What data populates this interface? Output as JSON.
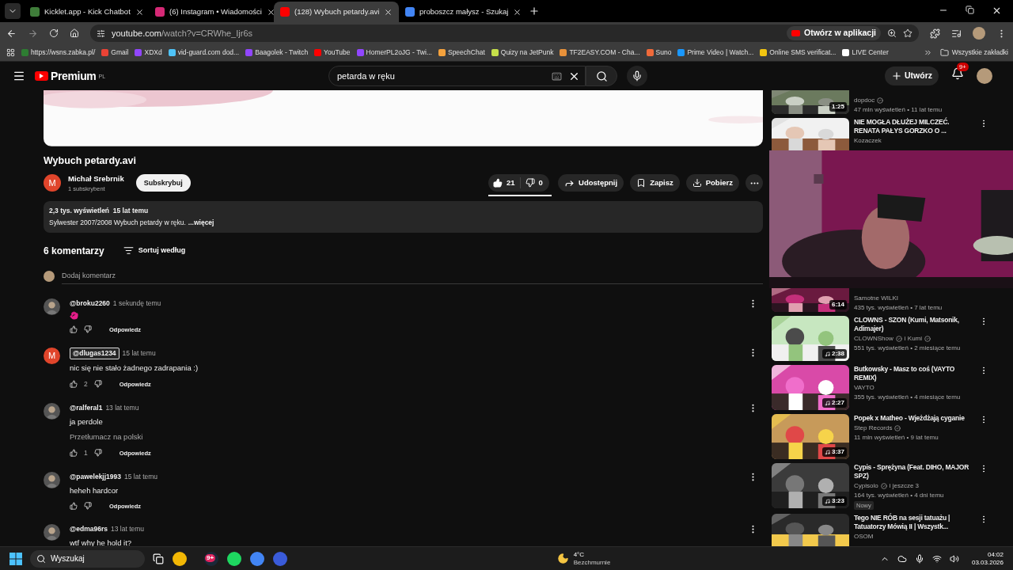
{
  "browser": {
    "tabs": [
      {
        "title": "Kicklet.app - Kick Chatbot",
        "selected": false,
        "color": "#3f7d3a"
      },
      {
        "title": "(6) Instagram • Wiadomości",
        "selected": false,
        "color": "#d62976"
      },
      {
        "title": "(128) Wybuch petardy.avi",
        "selected": true,
        "color": "#ff0000"
      },
      {
        "title": "proboszcz małysz - Szukaj",
        "selected": false,
        "color": "#4285f4"
      }
    ],
    "address": {
      "host": "youtube.com",
      "path": "/watch?v=CRWhe_Ijr6s"
    },
    "open_in_app": "Otwórz w aplikacji",
    "bookmarks": [
      {
        "label": "https://wsns.zabka.pl/",
        "color": "#2e7d32"
      },
      {
        "label": "Gmail",
        "color": "#ea4335"
      },
      {
        "label": "XDXd",
        "color": "#9146ff"
      },
      {
        "label": "vid-guard.com dod...",
        "color": "#4fc3f7"
      },
      {
        "label": "Baagolek - Twitch",
        "color": "#9146ff"
      },
      {
        "label": "YouTube",
        "color": "#ff0000"
      },
      {
        "label": "HomerPL2oJG - Twi...",
        "color": "#9146ff"
      },
      {
        "label": "SpeechChat",
        "color": "#f5a23d"
      },
      {
        "label": "Quizy na JetPunk",
        "color": "#c6e04a"
      },
      {
        "label": "TF2EASY.COM - Cha...",
        "color": "#e8913a"
      },
      {
        "label": "Suno",
        "color": "#f06a3a"
      },
      {
        "label": "Prime Video | Watch...",
        "color": "#1a98ff"
      },
      {
        "label": "Online SMS verificat...",
        "color": "#f2c511"
      },
      {
        "label": "LIVE Center",
        "color": "#ffffff"
      }
    ],
    "all_bookmarks": "Wszystkie zakładki"
  },
  "youtube": {
    "logo": "Premium",
    "region": "PL",
    "search": "petarda w ręku",
    "create": "Utwórz",
    "notifications": "9+"
  },
  "video": {
    "title": "Wybuch petardy.avi",
    "channel": "Michał Srebrnik",
    "avatar_letter": "M",
    "subscribers": "1 subskrybent",
    "subscribe": "Subskrybuj",
    "likes": "21",
    "dislikes": "0",
    "share": "Udostępnij",
    "save": "Zapisz",
    "download": "Pobierz"
  },
  "description": {
    "stats": "2,3 tys. wyświetleń  15 lat temu",
    "text": "Sylwester 2007/2008 Wybuch petardy w ręku.",
    "more": "...więcej"
  },
  "comments": {
    "count": "6 komentarzy",
    "sort": "Sortuj według",
    "placeholder": "Dodaj komentarz",
    "items": [
      {
        "author": "@broku2260",
        "time": "1 sekundę temu",
        "kind": "emoji",
        "highlighted": false,
        "reply": "Odpowiedz"
      },
      {
        "author": "@dlugas1234",
        "time": "15 lat temu",
        "kind": "text",
        "text": "nic się nie stało żadnego zadrapania :)",
        "letter": "M",
        "likes": "2",
        "highlighted": true,
        "reply": "Odpowiedz"
      },
      {
        "author": "@ralferal1",
        "time": "13 lat temu",
        "kind": "text",
        "text": "ja perdole",
        "translate": "Przetłumacz na polski",
        "likes": "1",
        "highlighted": false,
        "reply": "Odpowiedz"
      },
      {
        "author": "@pawelekjj1993",
        "time": "15 lat temu",
        "kind": "text",
        "text": "heheh hardcor",
        "highlighted": false,
        "reply": "Odpowiedz"
      },
      {
        "author": "@edma96rs",
        "time": "13 lat temu",
        "kind": "text",
        "text": "wtf why he hold it?",
        "highlighted": false
      }
    ]
  },
  "sidebar": [
    {
      "channel": "dopdoc",
      "verified": true,
      "stats": "47 mln wyświetleń • 11 lat temu",
      "duration": "1:25",
      "music": false,
      "cut_top": true
    },
    {
      "title": "NIE MOGŁA DŁUŻEJ MILCZEĆ. RENATA PAŁYS GORZKO O ...",
      "channel": "Kozaczek",
      "verified": false,
      "cut_bottom": true
    },
    {
      "channel": "Samotne WILKI",
      "verified": false,
      "stats": "435 tys. wyświetleń • 7 lat temu",
      "duration": "6:14",
      "music": false,
      "cut_top": true
    },
    {
      "title": "CLOWNS - SZON (Kumi, Matsonik, Adimajer)",
      "channel": "CLOWNShow",
      "verified": true,
      "extra": "i Kumi",
      "extra_verified": true,
      "stats": "551 tys. wyświetleń • 2 miesiące temu",
      "duration": "2:38",
      "music": true
    },
    {
      "title": "Butkowsky - Masz to coś (VAYTO REMIX)",
      "channel": "VAYTO",
      "verified": false,
      "stats": "355 tys. wyświetleń • 4 miesiące temu",
      "duration": "2:27",
      "music": true
    },
    {
      "title": "Popek x Matheo - Wjeżdżają cyganie",
      "channel": "Step Records",
      "verified": true,
      "stats": "11 mln wyświetleń • 9 lat temu",
      "duration": "3:37",
      "music": true
    },
    {
      "title": "Cypis - Sprężyna (Feat. DIHO, MAJOR SPZ)",
      "channel": "Cypisolo",
      "verified": true,
      "extra": "i jeszcze 3",
      "extra_verified": false,
      "stats": "164 tys. wyświetleń • 4 dni temu",
      "badge": "Nowy",
      "duration": "3:23",
      "music": true
    },
    {
      "title": "Tego NIE RÓB na sesji tatuażu | Tatuatorzy Mówią II | Wszystk...",
      "channel": "OSOM",
      "verified": false,
      "cut_bottom": true
    }
  ],
  "taskbar": {
    "search": "Wyszukaj",
    "discord_badge": "9+",
    "temperature": "4°C",
    "weather": "Bezchmurnie",
    "time": "04:02",
    "date": "03.03.2026"
  }
}
